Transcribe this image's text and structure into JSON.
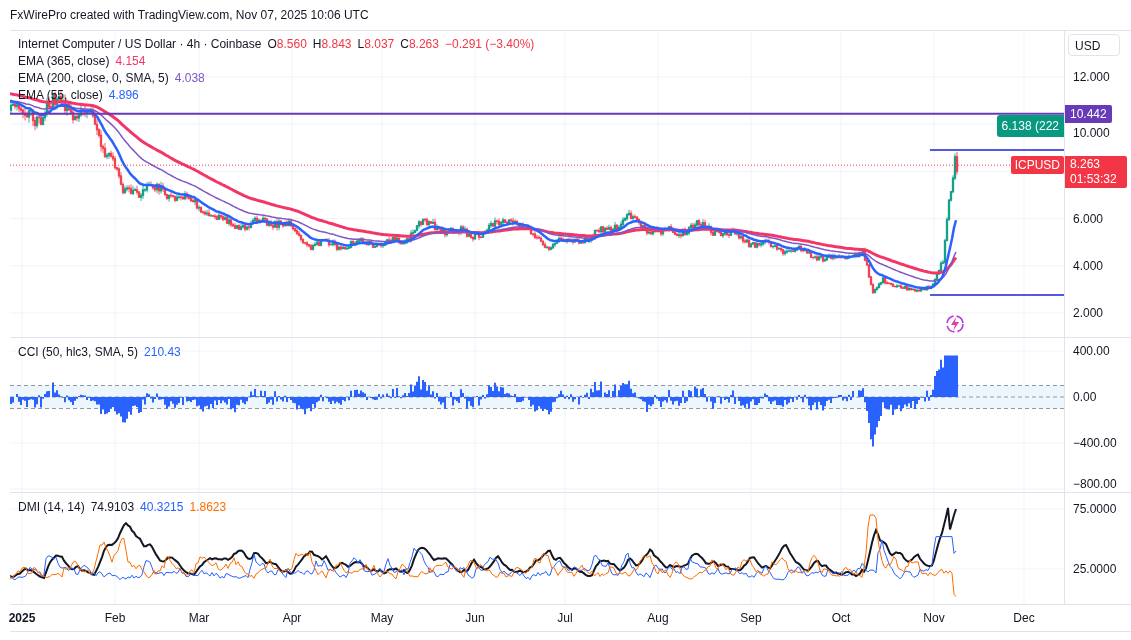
{
  "header": {
    "text": "FxWirePro created with TradingView.com, Nov 07, 2025 10:06 UTC"
  },
  "symbol": {
    "title": "Internet Computer / US Dollar · 4h · Coinbase",
    "ohlc": [
      {
        "label": "O",
        "value": "8.560"
      },
      {
        "label": "H",
        "value": "8.843"
      },
      {
        "label": "L",
        "value": "8.037"
      },
      {
        "label": "C",
        "value": "8.263"
      }
    ],
    "change": "−0.291 (−3.40%)"
  },
  "indicators": [
    {
      "name": "EMA (365, close)",
      "value": "4.154",
      "color": "#f23668"
    },
    {
      "name": "EMA (200, close, 0, SMA, 5)",
      "value": "4.038",
      "color": "#7e57c2"
    },
    {
      "name": "EMA (55, close)",
      "value": "4.896",
      "color": "#2962ff"
    }
  ],
  "currency_button": "USD",
  "price_axis": {
    "ticks": [
      "12.000",
      "10.000",
      "6.000",
      "4.000",
      "2.000"
    ]
  },
  "level_label": "10.442",
  "symbol_tag": "ICPUSD",
  "last_price": "8.263",
  "countdown": "01:53:32",
  "range_label": "6.138 (222",
  "cci": {
    "name": "CCI (50, hlc3, SMA, 5)",
    "value": "210.43",
    "ticks": [
      "400.00",
      "0.00",
      "−400.00",
      "−800.00"
    ]
  },
  "dmi": {
    "name": "DMI (14, 14)",
    "values": [
      {
        "text": "74.9103",
        "color": "#131722"
      },
      {
        "text": "40.3215",
        "color": "#2962ff"
      },
      {
        "text": "1.8623",
        "color": "#ff6d00"
      }
    ],
    "ticks": [
      "75.0000",
      "25.0000"
    ]
  },
  "time_axis": [
    {
      "label": "2025",
      "kind": "year"
    },
    {
      "label": "Feb",
      "kind": "month"
    },
    {
      "label": "Mar",
      "kind": "month"
    },
    {
      "label": "Apr",
      "kind": "month"
    },
    {
      "label": "May",
      "kind": "month"
    },
    {
      "label": "Jun",
      "kind": "month"
    },
    {
      "label": "Jul",
      "kind": "month"
    },
    {
      "label": "Aug",
      "kind": "month"
    },
    {
      "label": "Sep",
      "kind": "month"
    },
    {
      "label": "Oct",
      "kind": "month"
    },
    {
      "label": "Nov",
      "kind": "month"
    },
    {
      "label": "Dec",
      "kind": "month"
    }
  ]
}
